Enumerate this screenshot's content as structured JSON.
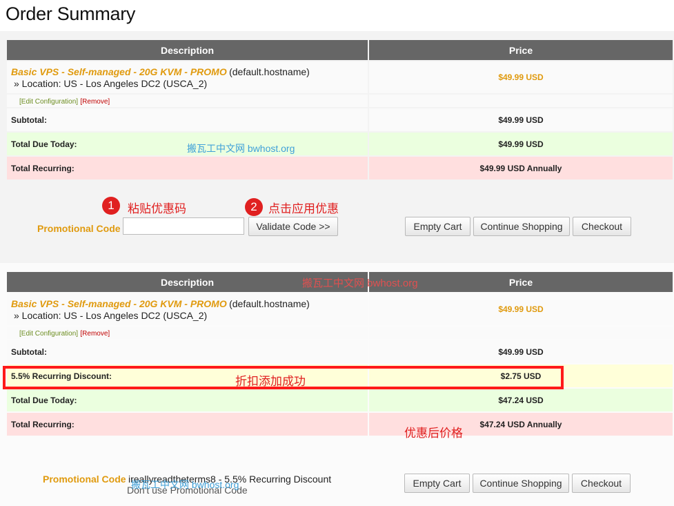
{
  "page": {
    "title": "Order Summary"
  },
  "cart1": {
    "headers": {
      "description": "Description",
      "price": "Price"
    },
    "item": {
      "name": "Basic VPS - Self-managed - 20G KVM - PROMO",
      "hostname": "(default.hostname)",
      "location": "» Location: US - Los Angeles DC2 (USCA_2)",
      "price": "$49.99 USD",
      "edit": "[Edit Configuration]",
      "remove": "[Remove]"
    },
    "subtotal": {
      "label": "Subtotal:",
      "value": "$49.99 USD"
    },
    "total_due": {
      "label": "Total Due Today:",
      "value": "$49.99 USD"
    },
    "total_recurring": {
      "label": "Total Recurring:",
      "value": "$49.99 USD Annually"
    }
  },
  "promo1": {
    "label": "Promotional Code",
    "input_value": "",
    "validate_button": "Validate Code >>"
  },
  "actions1": {
    "empty_cart": "Empty Cart",
    "continue_shopping": "Continue Shopping",
    "checkout": "Checkout"
  },
  "annotations": {
    "step1_number": "1",
    "step1_text": "粘贴优惠码",
    "step2_number": "2",
    "step2_text": "点击应用优惠",
    "discount_success": "折扣添加成功",
    "after_discount": "优惠后价格"
  },
  "watermarks": {
    "wm1": "搬瓦工中文网 bwhost.org",
    "wm2": "搬瓦工中文网 bwhost.org",
    "wm3": "搬瓦工中文网 bwhost.org"
  },
  "cart2": {
    "headers": {
      "description": "Description",
      "price": "Price"
    },
    "item": {
      "name": "Basic VPS - Self-managed - 20G KVM - PROMO",
      "hostname": "(default.hostname)",
      "location": "» Location: US - Los Angeles DC2 (USCA_2)",
      "price": "$49.99 USD",
      "edit": "[Edit Configuration]",
      "remove": "[Remove]"
    },
    "subtotal": {
      "label": "Subtotal:",
      "value": "$49.99 USD"
    },
    "discount": {
      "label": "5.5% Recurring Discount:",
      "value": "$2.75 USD"
    },
    "total_due": {
      "label": "Total Due Today:",
      "value": "$47.24 USD"
    },
    "total_recurring": {
      "label": "Total Recurring:",
      "value": "$47.24 USD Annually"
    }
  },
  "promo2": {
    "label": "Promotional Code",
    "applied": "ireallyreadtheterms8 - 5.5% Recurring Discount",
    "dont_use": "Don't use Promotional Code"
  },
  "actions2": {
    "empty_cart": "Empty Cart",
    "continue_shopping": "Continue Shopping",
    "checkout": "Checkout"
  },
  "colors": {
    "accent_orange": "#e09a0e",
    "header_gray": "#666666",
    "total_green": "#ebffdf",
    "recurring_pink": "#ffdfdf",
    "discount_yellow": "#ffffd9",
    "annotation_red": "#e02020"
  }
}
